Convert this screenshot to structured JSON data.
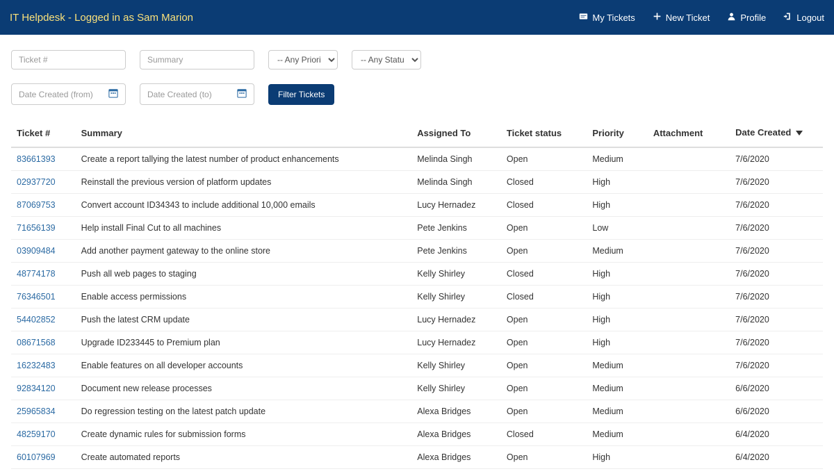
{
  "navbar": {
    "brand": "IT Helpdesk - Logged in as Sam Marion",
    "links": {
      "my_tickets": "My Tickets",
      "new_ticket": "New Ticket",
      "profile": "Profile",
      "logout": "Logout"
    }
  },
  "filters": {
    "ticket_num_placeholder": "Ticket #",
    "summary_placeholder": "Summary",
    "priority_placeholder": "-- Any Priority --",
    "status_placeholder": "-- Any Status --",
    "date_from_placeholder": "Date Created (from)",
    "date_to_placeholder": "Date Created (to)",
    "filter_button": "Filter Tickets"
  },
  "table": {
    "headers": {
      "ticket": "Ticket #",
      "summary": "Summary",
      "assigned": "Assigned To",
      "status": "Ticket status",
      "priority": "Priority",
      "attachment": "Attachment",
      "date": "Date Created"
    },
    "rows": [
      {
        "ticket": "83661393",
        "summary": "Create a report tallying the latest number of product enhancements",
        "assigned": "Melinda Singh",
        "status": "Open",
        "priority": "Medium",
        "date": "7/6/2020"
      },
      {
        "ticket": "02937720",
        "summary": "Reinstall the previous version of platform updates",
        "assigned": "Melinda Singh",
        "status": "Closed",
        "priority": "High",
        "date": "7/6/2020"
      },
      {
        "ticket": "87069753",
        "summary": "Convert account ID34343 to include additional 10,000 emails",
        "assigned": "Lucy Hernadez",
        "status": "Closed",
        "priority": "High",
        "date": "7/6/2020"
      },
      {
        "ticket": "71656139",
        "summary": "Help install Final Cut to all machines",
        "assigned": "Pete Jenkins",
        "status": "Open",
        "priority": "Low",
        "date": "7/6/2020"
      },
      {
        "ticket": "03909484",
        "summary": "Add another payment gateway to the online store",
        "assigned": "Pete Jenkins",
        "status": "Open",
        "priority": "Medium",
        "date": "7/6/2020"
      },
      {
        "ticket": "48774178",
        "summary": "Push all web pages to staging",
        "assigned": "Kelly Shirley",
        "status": "Closed",
        "priority": "High",
        "date": "7/6/2020"
      },
      {
        "ticket": "76346501",
        "summary": "Enable access permissions",
        "assigned": "Kelly Shirley",
        "status": "Closed",
        "priority": "High",
        "date": "7/6/2020"
      },
      {
        "ticket": "54402852",
        "summary": "Push the latest CRM update",
        "assigned": "Lucy Hernadez",
        "status": "Open",
        "priority": "High",
        "date": "7/6/2020"
      },
      {
        "ticket": "08671568",
        "summary": "Upgrade ID233445 to Premium plan",
        "assigned": "Lucy Hernadez",
        "status": "Open",
        "priority": "High",
        "date": "7/6/2020"
      },
      {
        "ticket": "16232483",
        "summary": "Enable features on all developer accounts",
        "assigned": "Kelly Shirley",
        "status": "Open",
        "priority": "Medium",
        "date": "7/6/2020"
      },
      {
        "ticket": "92834120",
        "summary": "Document new release processes",
        "assigned": "Kelly Shirley",
        "status": "Open",
        "priority": "Medium",
        "date": "6/6/2020"
      },
      {
        "ticket": "25965834",
        "summary": "Do regression testing on the latest patch update",
        "assigned": "Alexa Bridges",
        "status": "Open",
        "priority": "Medium",
        "date": "6/6/2020"
      },
      {
        "ticket": "48259170",
        "summary": "Create dynamic rules for submission forms",
        "assigned": "Alexa Bridges",
        "status": "Closed",
        "priority": "Medium",
        "date": "6/4/2020"
      },
      {
        "ticket": "60107969",
        "summary": "Create automated reports",
        "assigned": "Alexa Bridges",
        "status": "Open",
        "priority": "High",
        "date": "6/4/2020"
      }
    ]
  }
}
